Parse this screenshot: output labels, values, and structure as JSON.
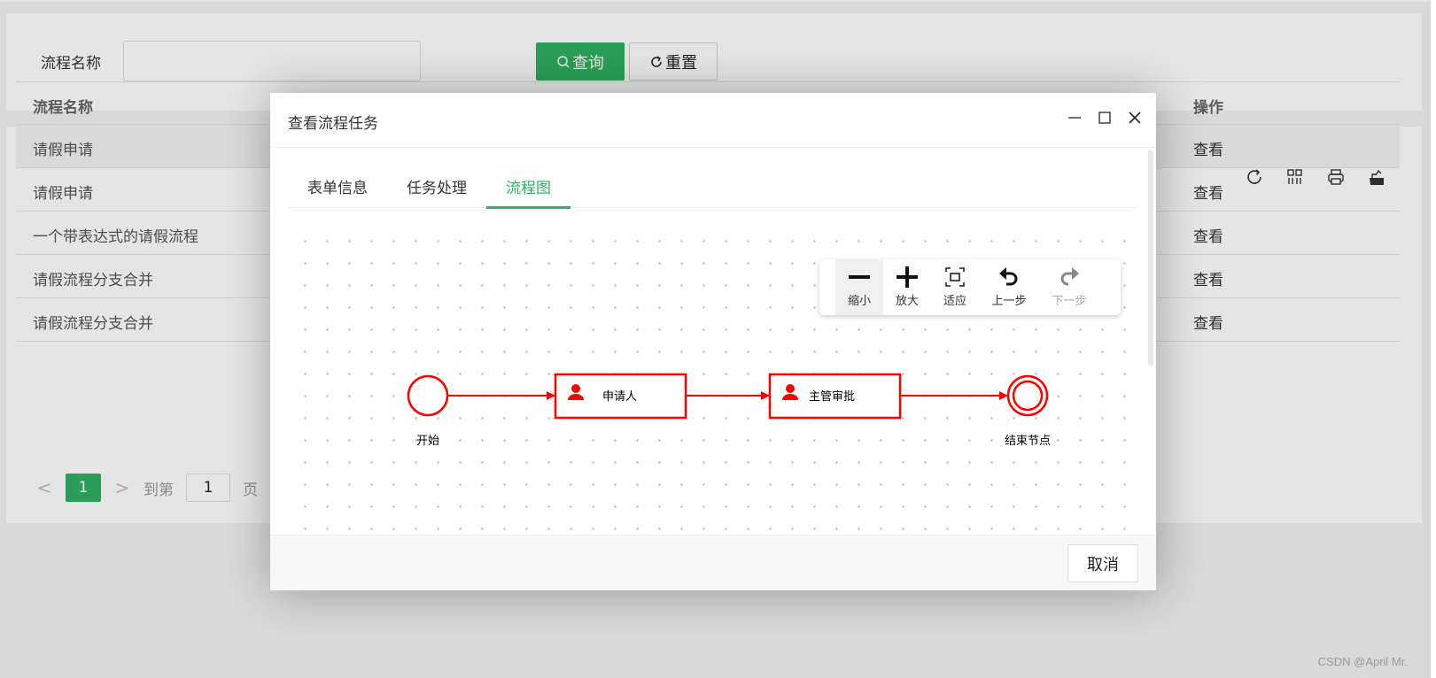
{
  "search": {
    "label": "流程名称",
    "input_value": "",
    "input_placeholder": "",
    "query_button": "查询",
    "reset_button": "重置"
  },
  "table": {
    "columns": [
      "流程名称",
      "操作"
    ],
    "rows": [
      {
        "name": "请假申请",
        "action": "查看"
      },
      {
        "name": "请假申请",
        "action": "查看"
      },
      {
        "name": "一个带表达式的请假流程",
        "action": "查看"
      },
      {
        "name": "请假流程分支合并",
        "action": "查看"
      },
      {
        "name": "请假流程分支合并",
        "action": "查看"
      }
    ],
    "tools": [
      "refresh-icon",
      "columns-icon",
      "print-icon",
      "export-icon"
    ]
  },
  "pagination": {
    "prev": "<",
    "current_page": "1",
    "next": ">",
    "goto_label": "到第",
    "goto_value": "1",
    "page_suffix": "页"
  },
  "modal": {
    "title": "查看流程任务",
    "tabs": [
      {
        "label": "表单信息",
        "active": false
      },
      {
        "label": "任务处理",
        "active": false
      },
      {
        "label": "流程图",
        "active": true
      }
    ],
    "zoom_toolbar": [
      {
        "icon": "zoom-out-icon",
        "label": "缩小",
        "enabled": true
      },
      {
        "icon": "zoom-in-icon",
        "label": "放大",
        "enabled": true
      },
      {
        "icon": "fit-icon",
        "label": "适应",
        "enabled": true
      },
      {
        "icon": "undo-icon",
        "label": "上一步",
        "enabled": true
      },
      {
        "icon": "redo-icon",
        "label": "下一步",
        "enabled": false
      }
    ],
    "flow": {
      "highlight_color": "#ff0000",
      "nodes": [
        {
          "type": "start",
          "label": "开始"
        },
        {
          "type": "task",
          "label": "申请人"
        },
        {
          "type": "task",
          "label": "主管审批"
        },
        {
          "type": "end",
          "label": "结束节点"
        }
      ]
    },
    "cancel_button": "取消"
  },
  "watermark": "CSDN @April Mr.",
  "colors": {
    "primary": "#2fb062",
    "flow_highlight": "#ff0000"
  }
}
